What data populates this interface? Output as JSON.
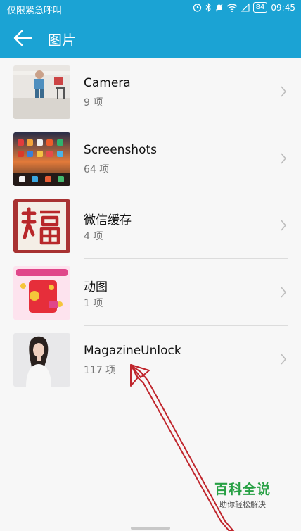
{
  "status_bar": {
    "carrier": "仅限紧急呼叫",
    "battery": "84",
    "time": "09:45"
  },
  "app_bar": {
    "back_icon": "arrow-left-icon",
    "title": "图片"
  },
  "albums": [
    {
      "name": "Camera",
      "count": "9 项"
    },
    {
      "name": "Screenshots",
      "count": "64 项"
    },
    {
      "name": "微信缓存",
      "count": "4 项"
    },
    {
      "name": "动图",
      "count": "1 项"
    },
    {
      "name": "MagazineUnlock",
      "count": "117 项"
    }
  ],
  "watermark": {
    "title": "百科全说",
    "subtitle": "助你轻松解决"
  },
  "colors": {
    "accent": "#1ba3d4",
    "arrow": "#c0262d",
    "watermark_green": "#27a044"
  }
}
